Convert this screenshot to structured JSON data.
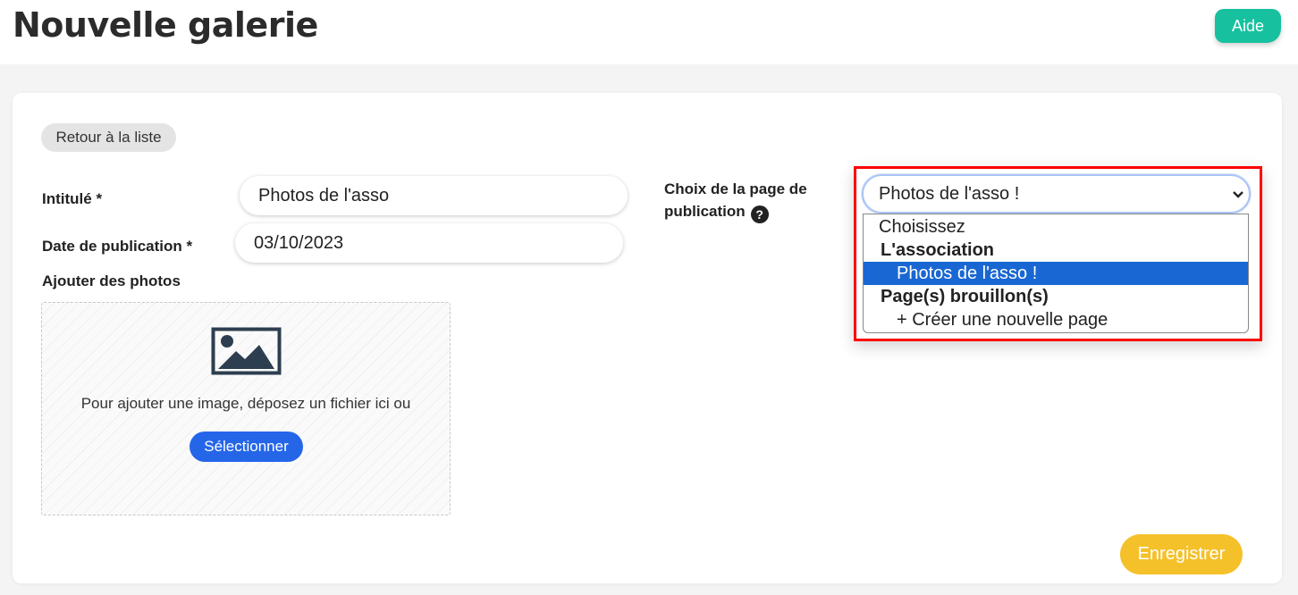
{
  "header": {
    "title": "Nouvelle galerie",
    "help_label": "Aide"
  },
  "form": {
    "back_label": "Retour à la liste",
    "title_label": "Intitulé *",
    "title_value": "Photos de l'asso",
    "date_label": "Date de publication *",
    "date_value": "03/10/2023",
    "photos_label": "Ajouter des photos",
    "dropzone_text": "Pour ajouter une image, déposez un fichier ici ou",
    "select_files_label": "Sélectionner",
    "page_choice_label_line1": "Choix de la page de",
    "page_choice_label_line2": "publication",
    "page_choice_selected": "Photos de l'asso !",
    "save_label": "Enregistrer"
  },
  "dropdown": {
    "options": [
      {
        "label": "Choisissez",
        "kind": "placeholder"
      },
      {
        "label": "L'association",
        "kind": "group"
      },
      {
        "label": "Photos de l'asso !",
        "kind": "option",
        "selected": true
      },
      {
        "label": "Page(s) brouillon(s)",
        "kind": "group"
      },
      {
        "label": "+ Créer une nouvelle page",
        "kind": "option"
      }
    ]
  },
  "icons": {
    "help": "question-circle-icon",
    "image": "image-icon",
    "chevron": "chevron-down-icon"
  },
  "colors": {
    "help_button": "#17c1a0",
    "select_button": "#2566e8",
    "save_button": "#f5c12a",
    "highlight_frame": "#ff0000",
    "selected_option": "#1967d2"
  }
}
